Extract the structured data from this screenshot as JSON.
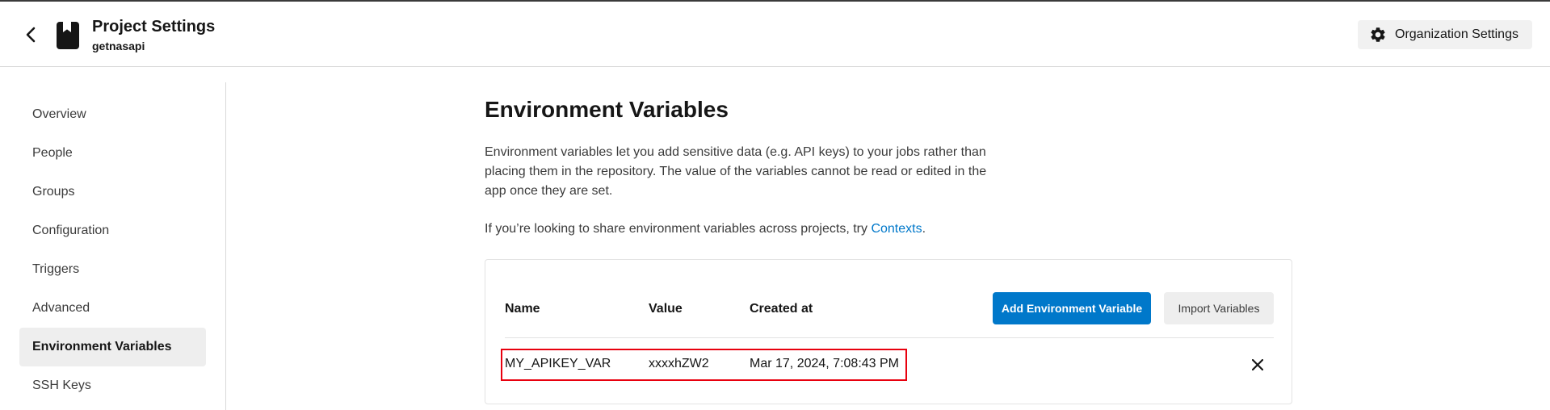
{
  "header": {
    "title": "Project Settings",
    "subtitle": "getnasapi",
    "org_settings_label": "Organization Settings",
    "icons": {
      "back": "chevron-left-icon",
      "project": "bookmark-icon",
      "org": "gear-icon"
    }
  },
  "sidebar": {
    "items": [
      {
        "label": "Overview",
        "active": false
      },
      {
        "label": "People",
        "active": false
      },
      {
        "label": "Groups",
        "active": false
      },
      {
        "label": "Configuration",
        "active": false
      },
      {
        "label": "Triggers",
        "active": false
      },
      {
        "label": "Advanced",
        "active": false
      },
      {
        "label": "Environment Variables",
        "active": true
      },
      {
        "label": "SSH Keys",
        "active": false
      }
    ]
  },
  "main": {
    "heading": "Environment Variables",
    "description": "Environment variables let you add sensitive data (e.g. API keys) to your jobs rather than placing them in the repository. The value of the variables cannot be read or edited in the app once they are set.",
    "share_prefix": "If you’re looking to share environment variables across projects, try ",
    "share_link": "Contexts",
    "share_suffix": "."
  },
  "table": {
    "columns": [
      "Name",
      "Value",
      "Created at"
    ],
    "add_button": "Add Environment Variable",
    "import_button": "Import Variables",
    "rows": [
      {
        "name": "MY_APIKEY_VAR",
        "value": "xxxxhZW2",
        "created_at": "Mar 17, 2024, 7:08:43 PM"
      }
    ]
  },
  "colors": {
    "accent": "#0078ca",
    "highlight": "#e8000e",
    "active_bg": "#eeeeee"
  }
}
